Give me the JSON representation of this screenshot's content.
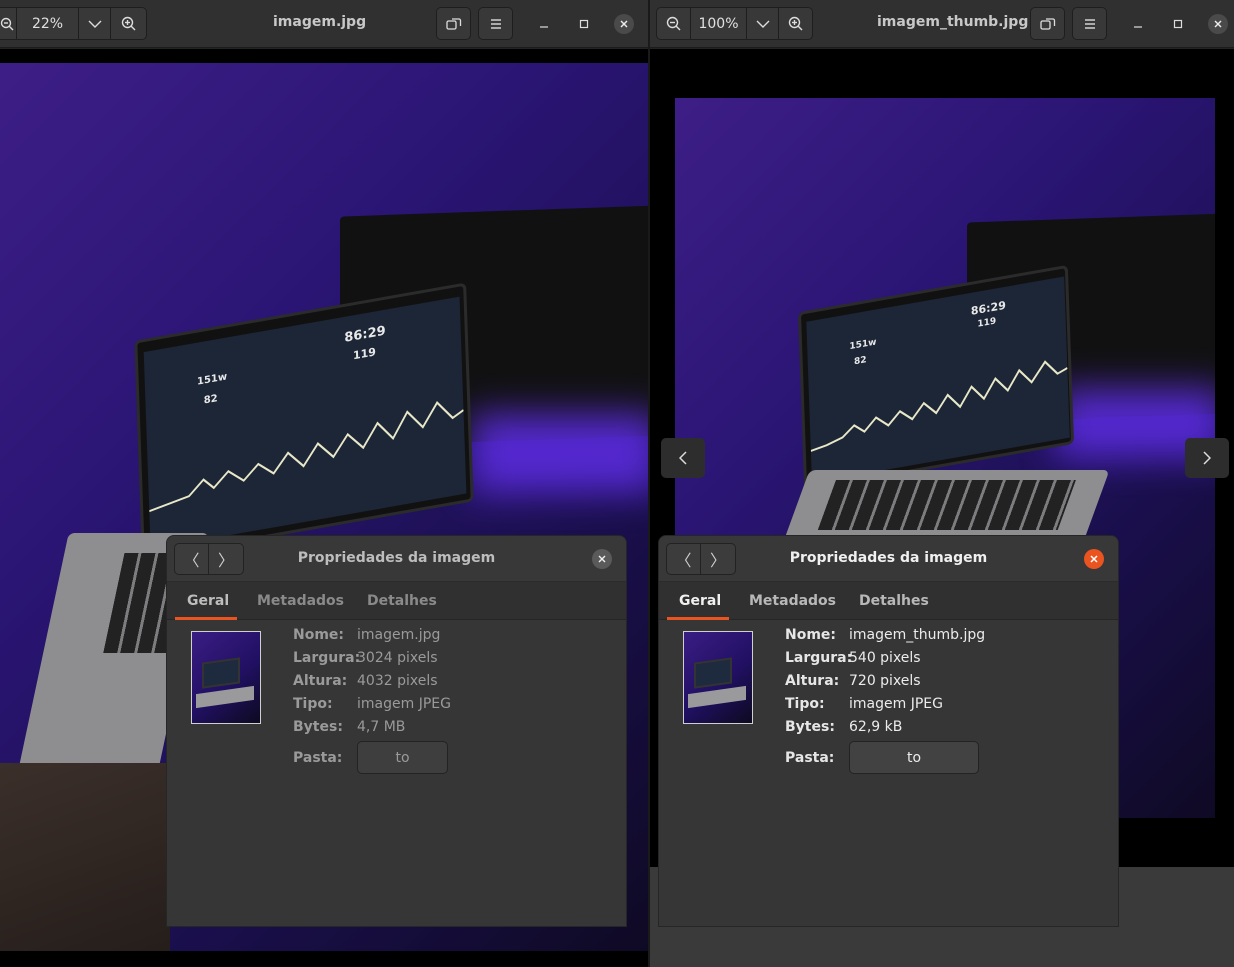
{
  "left": {
    "zoom": "22%",
    "title": "imagem.jpg",
    "dialog": {
      "title": "Propriedades da imagem",
      "tabs": [
        "Geral",
        "Metadados",
        "Detalhes"
      ],
      "labels": {
        "name": "Nome:",
        "width": "Largura:",
        "height": "Altura:",
        "type": "Tipo:",
        "bytes": "Bytes:",
        "folder": "Pasta:"
      },
      "values": {
        "name": "imagem.jpg",
        "width": "3024 pixels",
        "height": "4032 pixels",
        "type": "imagem JPEG",
        "bytes": "4,7 MB",
        "folder": "to"
      }
    }
  },
  "right": {
    "zoom": "100%",
    "title": "imagem_thumb.jpg",
    "dialog": {
      "title": "Propriedades da imagem",
      "tabs": [
        "Geral",
        "Metadados",
        "Detalhes"
      ],
      "labels": {
        "name": "Nome:",
        "width": "Largura:",
        "height": "Altura:",
        "type": "Tipo:",
        "bytes": "Bytes:",
        "folder": "Pasta:"
      },
      "values": {
        "name": "imagem_thumb.jpg",
        "width": "540 pixels",
        "height": "720 pixels",
        "type": "imagem JPEG",
        "bytes": "62,9 kB",
        "folder": "to"
      }
    }
  },
  "photo_text": {
    "power": "151w",
    "hr": "82",
    "time": "86:29",
    "cadence": "119"
  },
  "icons": {
    "minimize": "minimize-icon",
    "maximize": "maximize-icon",
    "close": "close-icon"
  },
  "colors": {
    "accent": "#e95420",
    "close_active": "#e95420"
  }
}
